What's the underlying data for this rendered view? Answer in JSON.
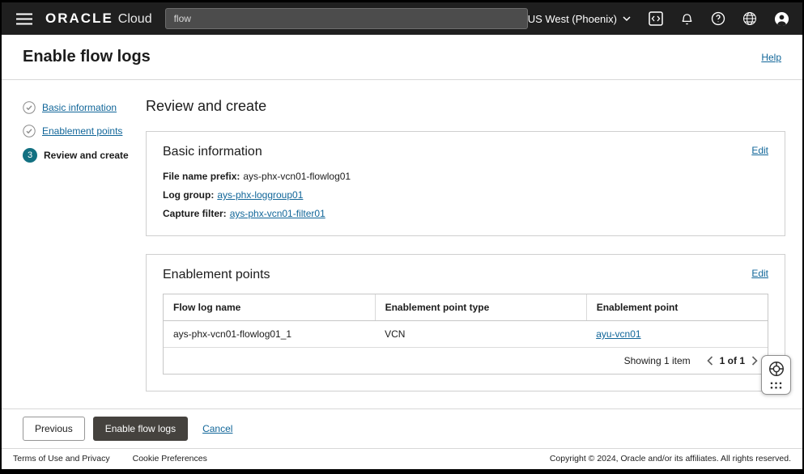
{
  "colors": {
    "topbar_bg": "#1f1f1f",
    "accent_link": "#116699",
    "step_active": "#127081",
    "primary_button": "#45423e"
  },
  "icons": {
    "hamburger": "☰",
    "dev_tools": "</>",
    "bell": "🔔",
    "help": "?",
    "globe": "🌐",
    "user": "👤",
    "chevron_down": "⌄",
    "chevron_left": "‹",
    "chevron_right": "›",
    "check_circle": "✓",
    "life_ring": "◎",
    "grid_dots": "⋮⋮"
  },
  "topbar": {
    "brand_oracle": "ORACLE",
    "brand_cloud": "Cloud",
    "search_value": "flow",
    "region": "US West (Phoenix)"
  },
  "header": {
    "title": "Enable flow logs",
    "help_label": "Help"
  },
  "wizard": {
    "steps": [
      {
        "label": "Basic information",
        "state": "complete"
      },
      {
        "label": "Enablement points",
        "state": "complete"
      },
      {
        "label": "Review and create",
        "state": "current",
        "number": "3"
      }
    ]
  },
  "main": {
    "title": "Review and create",
    "basic_info": {
      "title": "Basic information",
      "edit_label": "Edit",
      "fields": [
        {
          "label": "File name prefix:",
          "value": "ays-phx-vcn01-flowlog01",
          "is_link": false
        },
        {
          "label": "Log group:",
          "value": "ays-phx-loggroup01",
          "is_link": true
        },
        {
          "label": "Capture filter:",
          "value": "ays-phx-vcn01-filter01",
          "is_link": true
        }
      ]
    },
    "enablement": {
      "title": "Enablement points",
      "edit_label": "Edit",
      "table": {
        "columns": [
          "Flow log name",
          "Enablement point type",
          "Enablement point"
        ],
        "rows": [
          {
            "flow_log_name": "ays-phx-vcn01-flowlog01_1",
            "type": "VCN",
            "point": "ayu-vcn01"
          }
        ],
        "showing": "Showing 1 item",
        "page": "1 of 1"
      }
    }
  },
  "actions": {
    "previous_label": "Previous",
    "enable_label": "Enable flow logs",
    "cancel_label": "Cancel"
  },
  "footer": {
    "terms_label": "Terms of Use and Privacy",
    "cookies_label": "Cookie Preferences",
    "copyright": "Copyright © 2024, Oracle and/or its affiliates. All rights reserved."
  }
}
